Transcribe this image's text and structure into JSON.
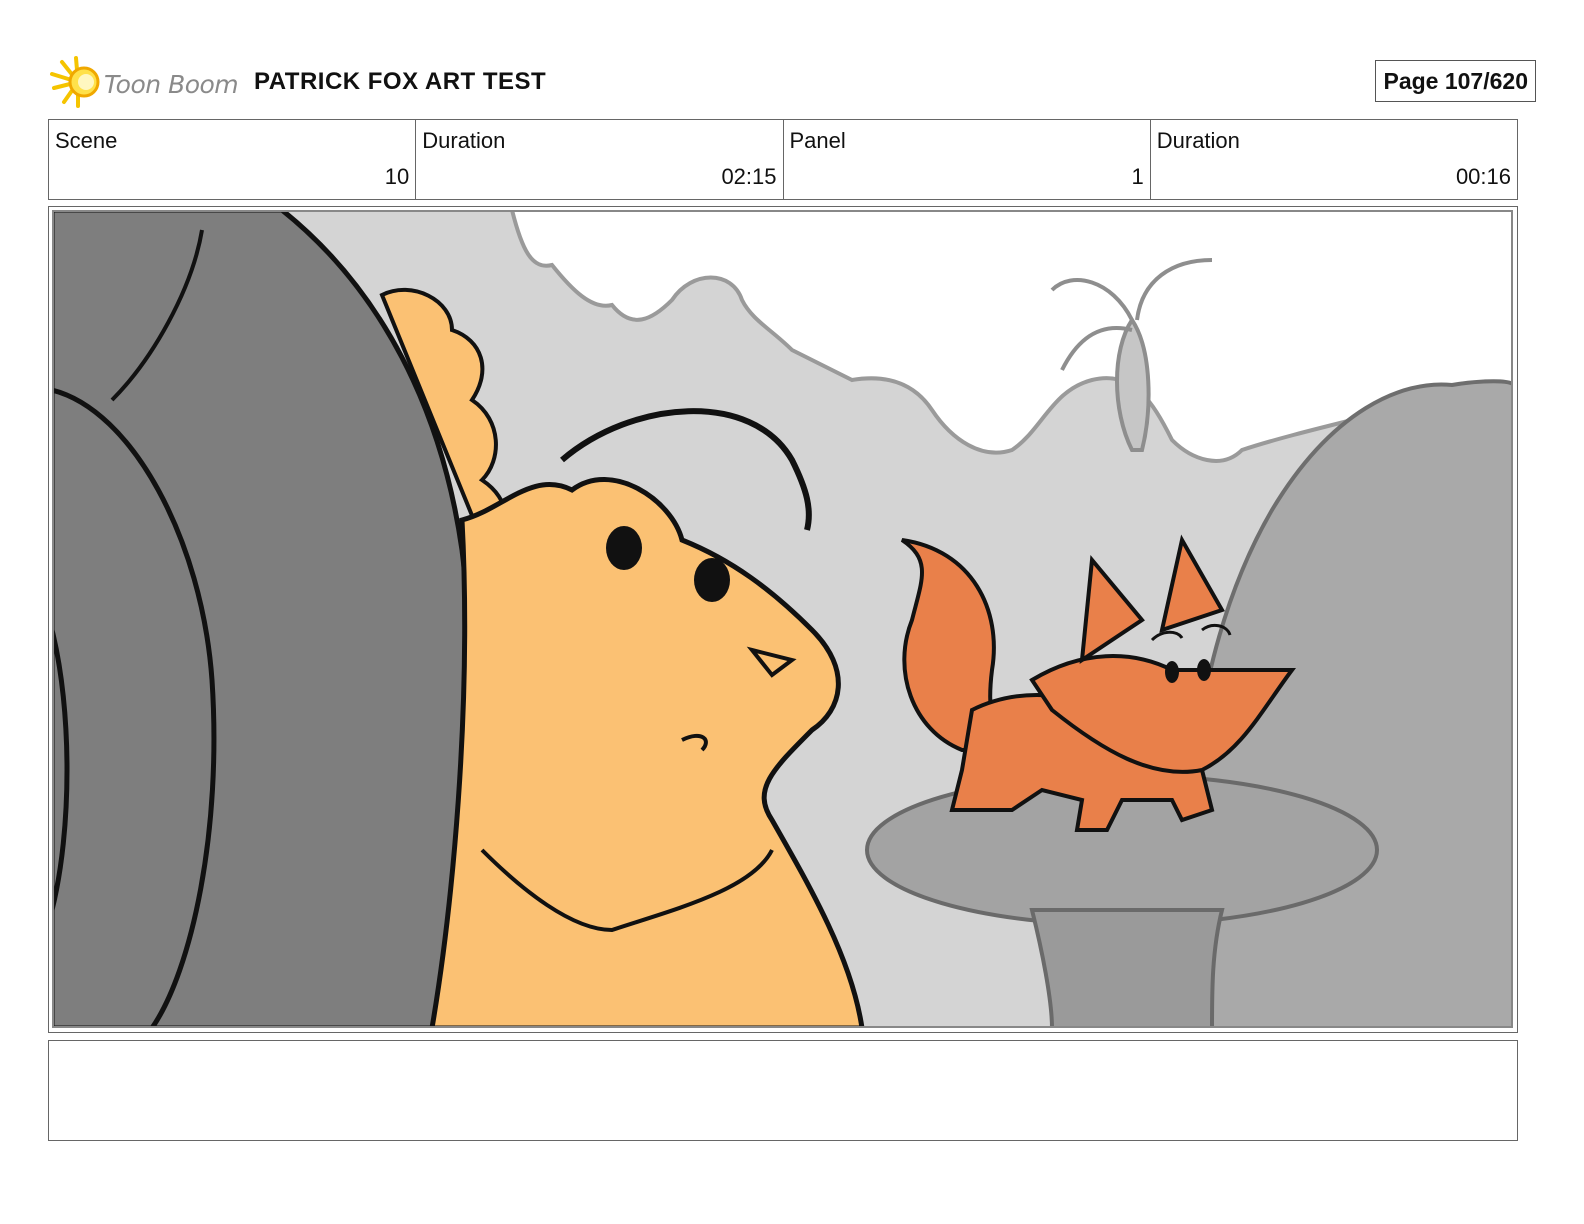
{
  "header": {
    "logo_text": "Toon Boom",
    "project_title": "PATRICK FOX ART TEST",
    "page_label": "Page 107/620"
  },
  "info": {
    "scene_label": "Scene",
    "scene_value": "10",
    "scene_duration_label": "Duration",
    "scene_duration_value": "02:15",
    "panel_label": "Panel",
    "panel_value": "1",
    "panel_duration_label": "Duration",
    "panel_duration_value": "00:16"
  },
  "panel_art": {
    "description_colors": {
      "background": "#d2d2d2",
      "sky": "#ffffff",
      "tree_dark": "#7e7e7e",
      "frog": "#fbc173",
      "fox": "#e9804a",
      "rock": "#9f9f9f"
    }
  },
  "notes": {
    "text": ""
  }
}
